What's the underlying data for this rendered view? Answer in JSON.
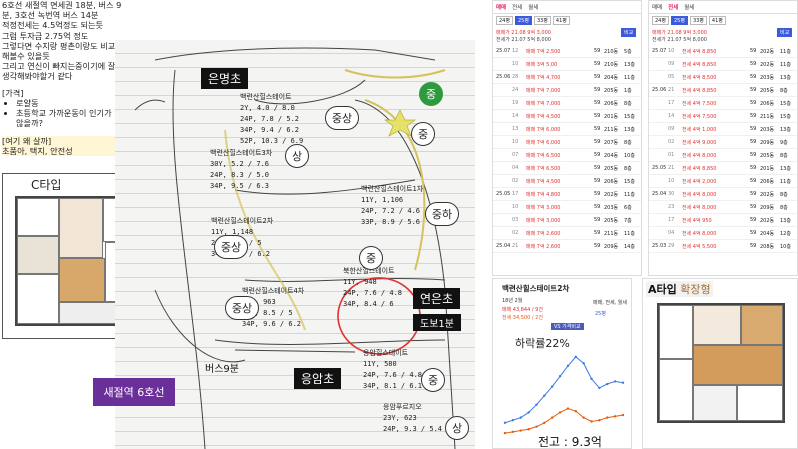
{
  "notes": {
    "lines": [
      "6호선 새절역 면세권 18분, 버스 9",
      "분, 3호선 녹번역 버스 14분",
      "적정전세는 4.5억정도 되는듯",
      "그럼 투자금 2.75억 정도",
      "그렇다면 수지랑 평촌이랑도 비교",
      "해볼수 있을듯",
      "그리고 연신이 빠지는중이기에 잘",
      "생각해봐야할거 같다"
    ],
    "price_header": "[가격]",
    "price_items": [
      "로얄동",
      "초등학교 가까운동이 인기가 많지 않을까?"
    ],
    "why_header": "[여기 왜 살까]",
    "why_text": "초품아, 택지, 안전성"
  },
  "ctype": {
    "label": "C타입"
  },
  "sketch": {
    "schools": [
      "은명초",
      "연은초",
      "응암초"
    ],
    "station": "새절역 6호선",
    "bus": "버스9분",
    "walk": "도보1분",
    "grades": {
      "g1": "중",
      "g2": "중상",
      "g3": "상",
      "g4": "중",
      "g5": "중하",
      "g6": "중상",
      "g7": "중",
      "g8": "중상",
      "g9": "중",
      "g10": "상"
    },
    "blocks": [
      "백련산힐스테이트\n2Y, 4.0 / 8.0\n24P, 7.8 / 5.2\n34P, 9.4 / 6.2\n52P, 10.3 / 6.9",
      "백련산힐스테이트3차\n30Y, 5.2 / 7.6\n24P, 8.3 / 5.0\n34P, 9.5 / 6.3",
      "백련산힐스테이트1차\n11Y, 1,106\n24P, 7.2 / 4.6\n33P, 8.9 / 5.6",
      "백련산힐스테이트2차\n11Y, 1,148\n24P, 8.5 / 5\n34P, 9.6 / 6.2",
      "백련산힐스테이트4차\n11Y, 963\n24P, 8.5 / 5\n34P, 9.6 / 6.2",
      "북한산힐스테이트\n11Y, 948\n24P, 7.6 / 4.8\n34P, 8.4 / 6",
      "응암힐스테이트\n11Y, 580\n24P, 7.6 / 4.8\n34P, 8.1 / 6.1",
      "응암푸르지오\n23Y, 623\n24P, 9.3 / 5.4"
    ]
  },
  "list1": {
    "tabs": [
      "매매",
      "전세",
      "월세"
    ],
    "chips": [
      "24평",
      "25평",
      "33평",
      "41평"
    ],
    "summary_sale": "매매가 21.08 9억 3,000",
    "summary_jeonse": "전세가 21.07 5억 8,000",
    "button": "비교",
    "rows": [
      [
        "25.07",
        "12",
        "매매 7억 2,500",
        "59",
        "210동",
        "5층"
      ],
      [
        "",
        "10",
        "매매 3억 5,00",
        "59",
        "210동",
        "13층"
      ],
      [
        "25.06",
        "28",
        "매매 7억 4,700",
        "59",
        "204동",
        "11층"
      ],
      [
        "",
        "24",
        "매매 7억 7,000",
        "59",
        "205동",
        "1층"
      ],
      [
        "",
        "19",
        "매매 7억 7,000",
        "59",
        "206동",
        "8층"
      ],
      [
        "",
        "14",
        "매매 7억 4,500",
        "59",
        "201동",
        "15층"
      ],
      [
        "",
        "13",
        "매매 7억 6,000",
        "59",
        "211동",
        "13층"
      ],
      [
        "",
        "10",
        "매매 7억 6,000",
        "59",
        "207동",
        "8층"
      ],
      [
        "",
        "07",
        "매매 7억 6,500",
        "59",
        "204동",
        "10층"
      ],
      [
        "",
        "04",
        "매매 7억 6,500",
        "59",
        "205동",
        "8층"
      ],
      [
        "",
        "02",
        "매매 7억 4,500",
        "59",
        "206동",
        "15층"
      ],
      [
        "25.05",
        "17",
        "매매 7억 4,800",
        "59",
        "202동",
        "11층"
      ],
      [
        "",
        "10",
        "매매 7억 3,000",
        "59",
        "203동",
        "6층"
      ],
      [
        "",
        "03",
        "매매 7억 3,000",
        "59",
        "205동",
        "7층"
      ],
      [
        "",
        "02",
        "매매 7억 2,600",
        "59",
        "211동",
        "11층"
      ],
      [
        "25.04",
        "21",
        "매매 7억 2,600",
        "59",
        "209동",
        "14층"
      ]
    ]
  },
  "list2": {
    "tabs": [
      "매매",
      "전세",
      "월세"
    ],
    "chips": [
      "24평",
      "25평",
      "33평",
      "41평"
    ],
    "summary_sale": "매매가 21.08 9억 3,000",
    "summary_jeonse": "전세가 21.07 5억 8,000",
    "button": "비교",
    "rows": [
      [
        "25.07",
        "10",
        "전세 4억 8,850",
        "59",
        "202동",
        "11층"
      ],
      [
        "",
        "09",
        "전세 4억 8,850",
        "59",
        "202동",
        "11층"
      ],
      [
        "",
        "05",
        "전세 4억 8,500",
        "59",
        "203동",
        "13층"
      ],
      [
        "25.06",
        "21",
        "전세 4억 8,850",
        "59",
        "205동",
        "8층"
      ],
      [
        "",
        "17",
        "전세 4억 7,500",
        "59",
        "206동",
        "15층"
      ],
      [
        "",
        "14",
        "전세 4억 7,500",
        "59",
        "211동",
        "15층"
      ],
      [
        "",
        "09",
        "전세 4억 1,000",
        "59",
        "203동",
        "13층"
      ],
      [
        "",
        "02",
        "전세 4억 9,000",
        "59",
        "209동",
        "9층"
      ],
      [
        "",
        "01",
        "전세 4억 8,000",
        "59",
        "205동",
        "8층"
      ],
      [
        "25.05",
        "21",
        "전세 4억 8,850",
        "59",
        "201동",
        "13층"
      ],
      [
        "",
        "10",
        "전세 4억 2,000",
        "59",
        "206동",
        "11층"
      ],
      [
        "25.04",
        "30",
        "전세 4억 8,000",
        "59",
        "202동",
        "8층"
      ],
      [
        "",
        "23",
        "전세 4억 8,000",
        "59",
        "209동",
        "8층"
      ],
      [
        "",
        "17",
        "전세 4억 950",
        "59",
        "202동",
        "13층"
      ],
      [
        "",
        "04",
        "전세 4억 8,000",
        "59",
        "204동",
        "12층"
      ],
      [
        "25.03",
        "29",
        "전세 4억 5,500",
        "59",
        "208동",
        "10층"
      ]
    ]
  },
  "chart": {
    "title": "백련산힐스테이트2차",
    "since": "18년 2월",
    "sale_summary": "매매 43,844 / 9건",
    "jeonse_summary": "전세 34,500 / 2건",
    "tabs": [
      "매매, 전세, 월세",
      "25평"
    ],
    "compare_chip": "VS 가격비교",
    "annotation": "하락률22%",
    "bottom_label": "전고 : 9.3억"
  },
  "chart_data": {
    "type": "line",
    "series": [
      {
        "name": "매매",
        "values": [
          4.2,
          4.4,
          4.6,
          5.0,
          5.6,
          6.3,
          7.0,
          7.8,
          8.6,
          9.3,
          8.8,
          7.6,
          6.9,
          7.2,
          7.4,
          7.3
        ]
      },
      {
        "name": "전세",
        "values": [
          3.4,
          3.5,
          3.6,
          3.7,
          3.9,
          4.2,
          4.6,
          5.0,
          5.3,
          5.1,
          4.6,
          4.3,
          4.4,
          4.6,
          4.7,
          4.8
        ]
      }
    ]
  },
  "atype": {
    "label": "A타입",
    "sub": "확장형"
  },
  "colors": {
    "accent": "#e03131",
    "primary": "#3b5bdb",
    "purple": "#6b2f9a",
    "green": "#2e9a3d",
    "highlight": "#fff6d6"
  }
}
